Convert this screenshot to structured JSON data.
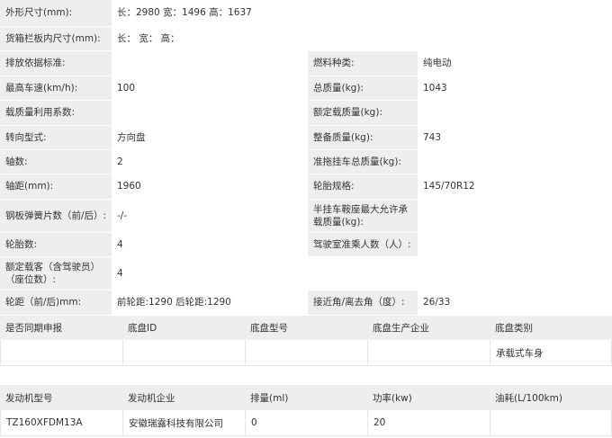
{
  "spec_rows": [
    {
      "label": "外形尺寸(mm):",
      "value": "长：2980 宽：1496 高：1637"
    },
    {
      "label": "货箱栏板内尺寸(mm):",
      "value": "长： 宽： 高："
    },
    {
      "label_left": "排放依据标准:",
      "value_left": "",
      "label_right": "燃料种类:",
      "value_right": "纯电动"
    },
    {
      "label_left": "最高车速(km/h):",
      "value_left": "100",
      "label_right": "总质量(kg):",
      "value_right": "1043"
    },
    {
      "label_left": "载质量利用系数:",
      "value_left": "",
      "label_right": "额定载质量(kg):",
      "value_right": ""
    },
    {
      "label_left": "转向型式:",
      "value_left": "方向盘",
      "label_right": "整备质量(kg):",
      "value_right": "743"
    },
    {
      "label_left": "轴数:",
      "value_left": "2",
      "label_right": "准拖挂车总质量(kg):",
      "value_right": ""
    },
    {
      "label_left": "轴距(mm):",
      "value_left": "1960",
      "label_right": "轮胎规格:",
      "value_right": "145/70R12"
    },
    {
      "label_left": "钢板弹簧片数（前/后）:",
      "value_left": "-/-",
      "label_right": "半挂车鞍座最大允许承载质量(kg):",
      "value_right": ""
    },
    {
      "label_left": "轮胎数:",
      "value_left": "4",
      "label_right": "驾驶室准乘人数（人）:",
      "value_right": ""
    },
    {
      "label": "额定载客（含驾驶员）（座位数）:",
      "value": "4"
    },
    {
      "label_left": "轮距（前/后)mm:",
      "value_left": "前轮距:1290 后轮距:1290",
      "label_right": "接近角/离去角（度）:",
      "value_right": "26/33"
    }
  ],
  "chassis_table": {
    "headers": [
      "是否同期申报",
      "底盘ID",
      "底盘型号",
      "底盘生产企业",
      "底盘类别"
    ],
    "row": [
      "",
      "",
      "",
      "",
      "承载式车身"
    ]
  },
  "engine_table": {
    "headers": [
      "发动机型号",
      "发动机企业",
      "排量(ml)",
      "功率(kw)",
      "油耗(L/100km)"
    ],
    "row": [
      "TZ160XFDM13A",
      "安徽瑞露科技有限公司",
      "0",
      "20",
      ""
    ]
  }
}
